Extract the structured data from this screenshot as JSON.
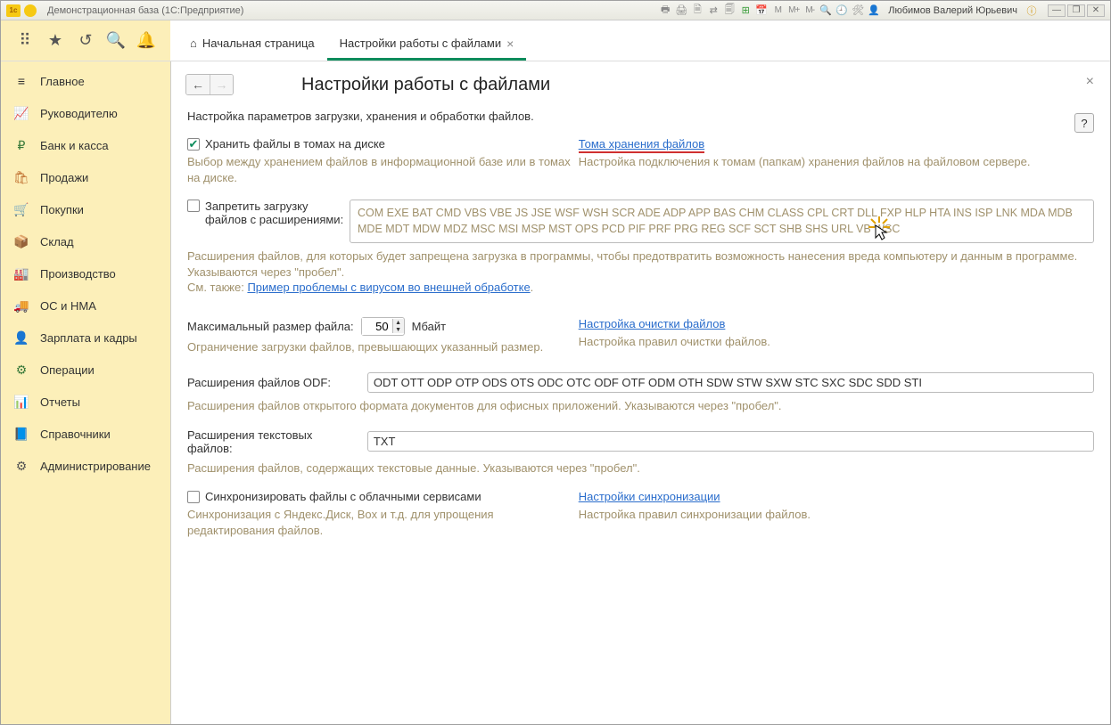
{
  "titlebar": {
    "app": "Демонстрационная база  (1С:Предприятие)",
    "user": "Любимов Валерий Юрьевич",
    "icons_m": [
      "М",
      "М+",
      "М-"
    ]
  },
  "tabs": {
    "home": "Начальная страница",
    "active": "Настройки работы с файлами"
  },
  "sidebar": {
    "items": [
      {
        "label": "Главное"
      },
      {
        "label": "Руководителю"
      },
      {
        "label": "Банк и касса"
      },
      {
        "label": "Продажи"
      },
      {
        "label": "Покупки"
      },
      {
        "label": "Склад"
      },
      {
        "label": "Производство"
      },
      {
        "label": "ОС и НМА"
      },
      {
        "label": "Зарплата и кадры"
      },
      {
        "label": "Операции"
      },
      {
        "label": "Отчеты"
      },
      {
        "label": "Справочники"
      },
      {
        "label": "Администрирование"
      }
    ]
  },
  "page": {
    "title": "Настройки работы с файлами",
    "intro": "Настройка параметров загрузки, хранения и обработки файлов.",
    "store_in_volumes": "Хранить файлы в томах на диске",
    "store_hint": "Выбор между хранением файлов в информационной базе или в томах на диске.",
    "volumes_link": "Тома хранения файлов",
    "volumes_hint": "Настройка подключения к томам (папкам) хранения файлов на файловом сервере.",
    "forbid_upload1": "Запретить загрузку",
    "forbid_upload2": "файлов с расширениями:",
    "ext_list": "COM EXE BAT CMD VBS VBE JS JSE WSF WSH SCR ADE ADP APP BAS CHM CLASS CPL CRT DLL FXP HLP HTA INS ISP LNK MDA MDB MDE MDT MDW MDZ MSC MSI MSP MST OPS PCD PIF PRF PRG REG SCF SCT SHB SHS URL VB WSC",
    "ext_hint1": "Расширения файлов, для которых будет запрещена загрузка в  программы, чтобы предотвратить возможность нанесения вреда компьютеру и  данным в программе. Указываются через \"пробел\".",
    "ext_hint2": "См. также: ",
    "ext_link": "Пример проблемы с вирусом во внешней  обработке",
    "max_size_label": "Максимальный размер файла:",
    "max_size_value": "50",
    "max_size_unit": "Мбайт",
    "max_size_hint": "Ограничение загрузки файлов, превышающих указанный размер.",
    "cleanup_link": "Настройка очистки файлов",
    "cleanup_hint": "Настройка правил очистки файлов.",
    "odf_label": "Расширения файлов ODF:",
    "odf_value": "ODT OTT ODP OTP ODS OTS ODC OTC ODF OTF ODM OTH SDW STW SXW STC SXC SDC SDD STI",
    "odf_hint": "Расширения файлов открытого формата документов для офисных приложений. Указываются через \"пробел\".",
    "txt_label": "Расширения текстовых файлов:",
    "txt_value": "TXT",
    "txt_hint": "Расширения файлов, содержащих текстовые данные. Указываются через \"пробел\".",
    "sync_chk": "Синхронизировать файлы с облачными сервисами",
    "sync_hint": "Синхронизация с Яндекс.Диск, Box и т.д. для упрощения редактирования файлов.",
    "sync_link": "Настройки синхронизации",
    "sync_link_hint": "Настройка правил синхронизации файлов."
  }
}
